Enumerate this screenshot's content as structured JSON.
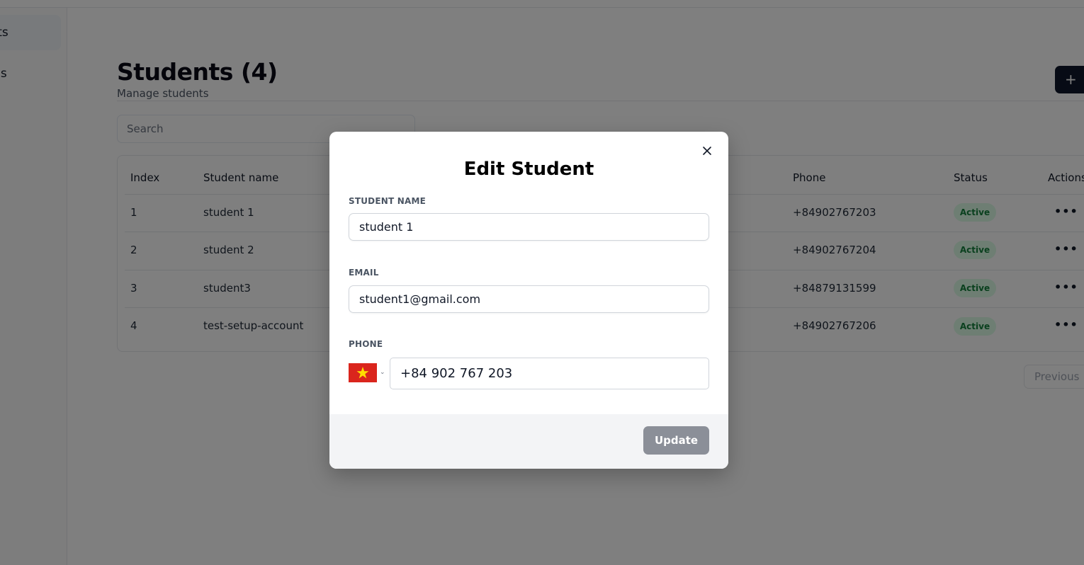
{
  "sidebar": {
    "items": [
      {
        "label": "Students",
        "active": true
      },
      {
        "label": "Sessions",
        "active": false
      }
    ]
  },
  "header": {
    "title": "Students (4)",
    "subtitle": "Manage students",
    "add_label": "+"
  },
  "search": {
    "placeholder": "Search"
  },
  "table": {
    "columns": [
      "Index",
      "Student name",
      "Phone",
      "Status",
      "Actions"
    ],
    "rows": [
      {
        "index": "1",
        "name": "student 1",
        "phone": "+84902767203",
        "status": "Active"
      },
      {
        "index": "2",
        "name": "student 2",
        "phone": "+84902767204",
        "status": "Active"
      },
      {
        "index": "3",
        "name": "student3",
        "phone": "+84879131599",
        "status": "Active"
      },
      {
        "index": "4",
        "name": "test-setup-account",
        "phone": "+84902767206",
        "status": "Active"
      }
    ],
    "actions_glyph": "•••"
  },
  "pagination": {
    "previous_label": "Previous"
  },
  "modal": {
    "title": "Edit Student",
    "name_label": "STUDENT NAME",
    "name_value": "student 1",
    "email_label": "EMAIL",
    "email_value": "student1@gmail.com",
    "phone_label": "PHONE",
    "phone_value": "+84 902 767 203",
    "update_label": "Update",
    "close_icon": "close-icon",
    "flag_icon": "vietnam-flag-icon"
  },
  "colors": {
    "primary_dark": "#0f172a",
    "badge_bg": "#dcfce7",
    "badge_text": "#15803d",
    "update_disabled": "#8b8f98"
  }
}
